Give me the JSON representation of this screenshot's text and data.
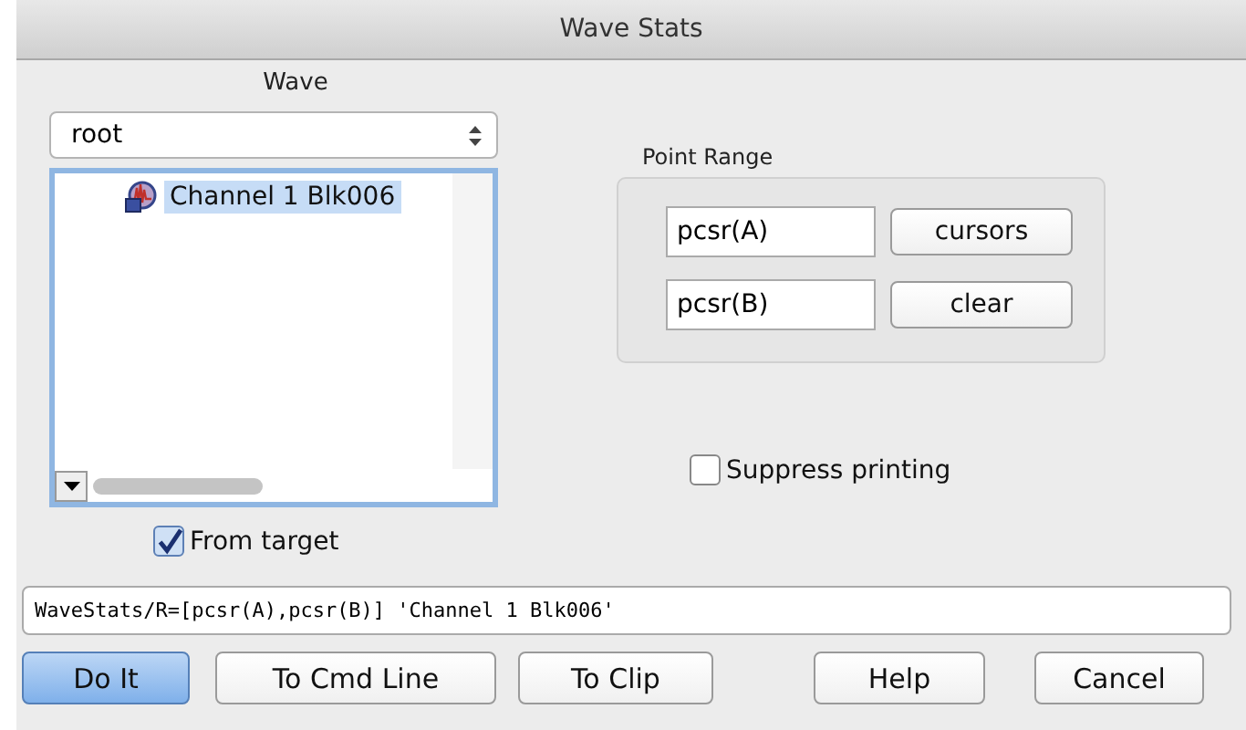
{
  "window": {
    "title": "Wave Stats"
  },
  "wave_panel": {
    "label": "Wave",
    "folder_select": {
      "value": "root"
    },
    "tree": [
      {
        "label": "Channel 1 Blk006",
        "selected": true
      }
    ],
    "from_target": {
      "label": "From target",
      "checked": true
    }
  },
  "point_range": {
    "label": "Point Range",
    "start": {
      "value": "pcsr(A)"
    },
    "end": {
      "value": "pcsr(B)"
    },
    "buttons": [
      "cursors",
      "clear"
    ]
  },
  "suppress_printing": {
    "label": "Suppress printing",
    "checked": false
  },
  "command": {
    "value": "WaveStats/R=[pcsr(A),pcsr(B)] 'Channel 1 Blk006'"
  },
  "buttons": [
    {
      "label": "Do It",
      "default": true
    },
    {
      "label": "To Cmd Line",
      "default": false
    },
    {
      "label": "To Clip",
      "default": false
    },
    {
      "label": "Help",
      "default": false
    },
    {
      "label": "Cancel",
      "default": false
    }
  ]
}
